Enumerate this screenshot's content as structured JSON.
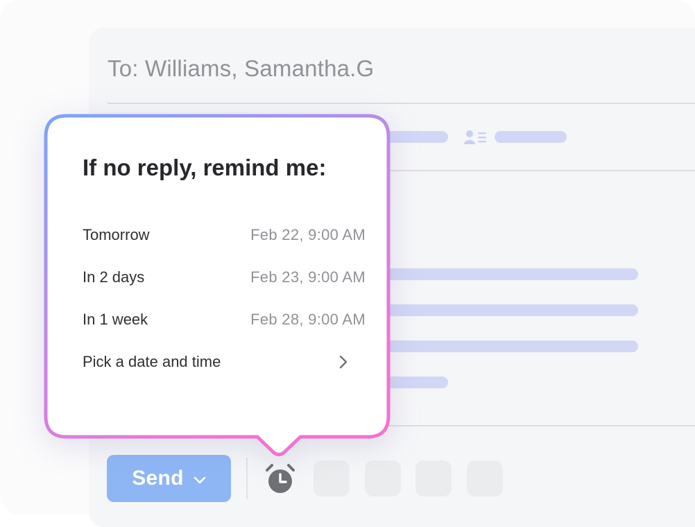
{
  "compose": {
    "to_label": "To:",
    "recipient": "Williams, Samantha.G"
  },
  "icons": {
    "contact": "contact-card-icon",
    "alarm": "alarm-clock-icon",
    "chevron_down": "chevron-down-icon",
    "chevron_right": "chevron-right-icon"
  },
  "colors": {
    "send_button": "#8eb6f5",
    "popover_gradient_start": "#7aa6f7",
    "popover_gradient_end": "#f472d0",
    "placeholder_bars": "#d2d7f6"
  },
  "toolbar": {
    "send_label": "Send"
  },
  "reminder_popover": {
    "title": "If no reply, remind me:",
    "options": [
      {
        "label": "Tomorrow",
        "time": "Feb 22, 9:00 AM"
      },
      {
        "label": "In 2 days",
        "time": "Feb 23, 9:00 AM"
      },
      {
        "label": "In 1 week",
        "time": "Feb 28, 9:00 AM"
      },
      {
        "label": "Pick a date and time",
        "time": ""
      }
    ]
  }
}
